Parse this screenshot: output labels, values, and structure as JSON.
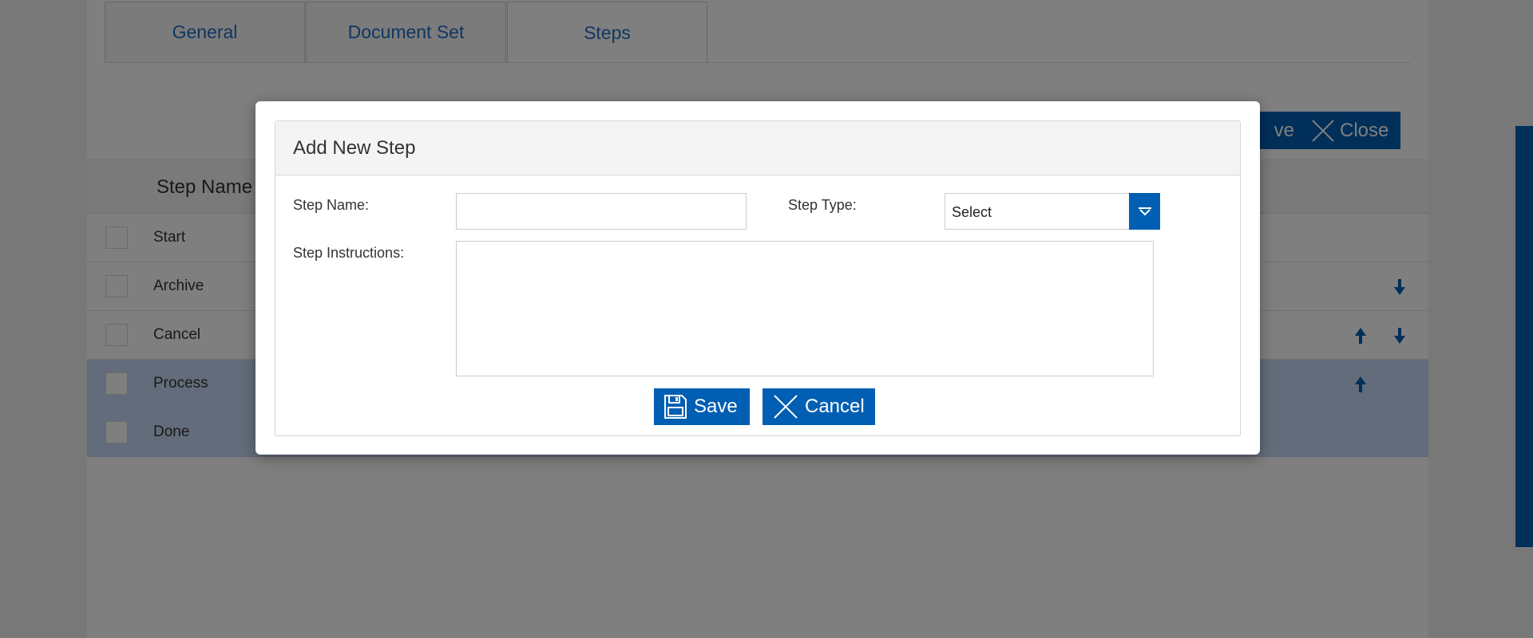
{
  "tabs": [
    {
      "label": "General"
    },
    {
      "label": "Document Set"
    },
    {
      "label": "Steps"
    }
  ],
  "toolbar": {
    "save_label": "ve",
    "close_label": "Close"
  },
  "grid": {
    "column_step_name": "Step Name",
    "rows": [
      {
        "label": "Start"
      },
      {
        "label": "Archive"
      },
      {
        "label": "Cancel"
      },
      {
        "label": "Process"
      },
      {
        "label": "Done"
      }
    ]
  },
  "modal": {
    "title": "Add New Step",
    "step_name_label": "Step Name:",
    "step_name_value": "",
    "step_type_label": "Step Type:",
    "step_type_value": "Select",
    "step_instructions_label": "Step Instructions:",
    "step_instructions_value": "",
    "save_label": "Save",
    "cancel_label": "Cancel"
  },
  "colors": {
    "accent": "#005fb2",
    "tab_text": "#1e6fc3",
    "selected_row": "#c6d9f5"
  },
  "icons": {
    "save": "floppy-disk-icon",
    "close": "x-icon",
    "move_up": "arrow-up-icon",
    "move_down": "arrow-down-icon",
    "dropdown": "chevron-down-icon"
  }
}
